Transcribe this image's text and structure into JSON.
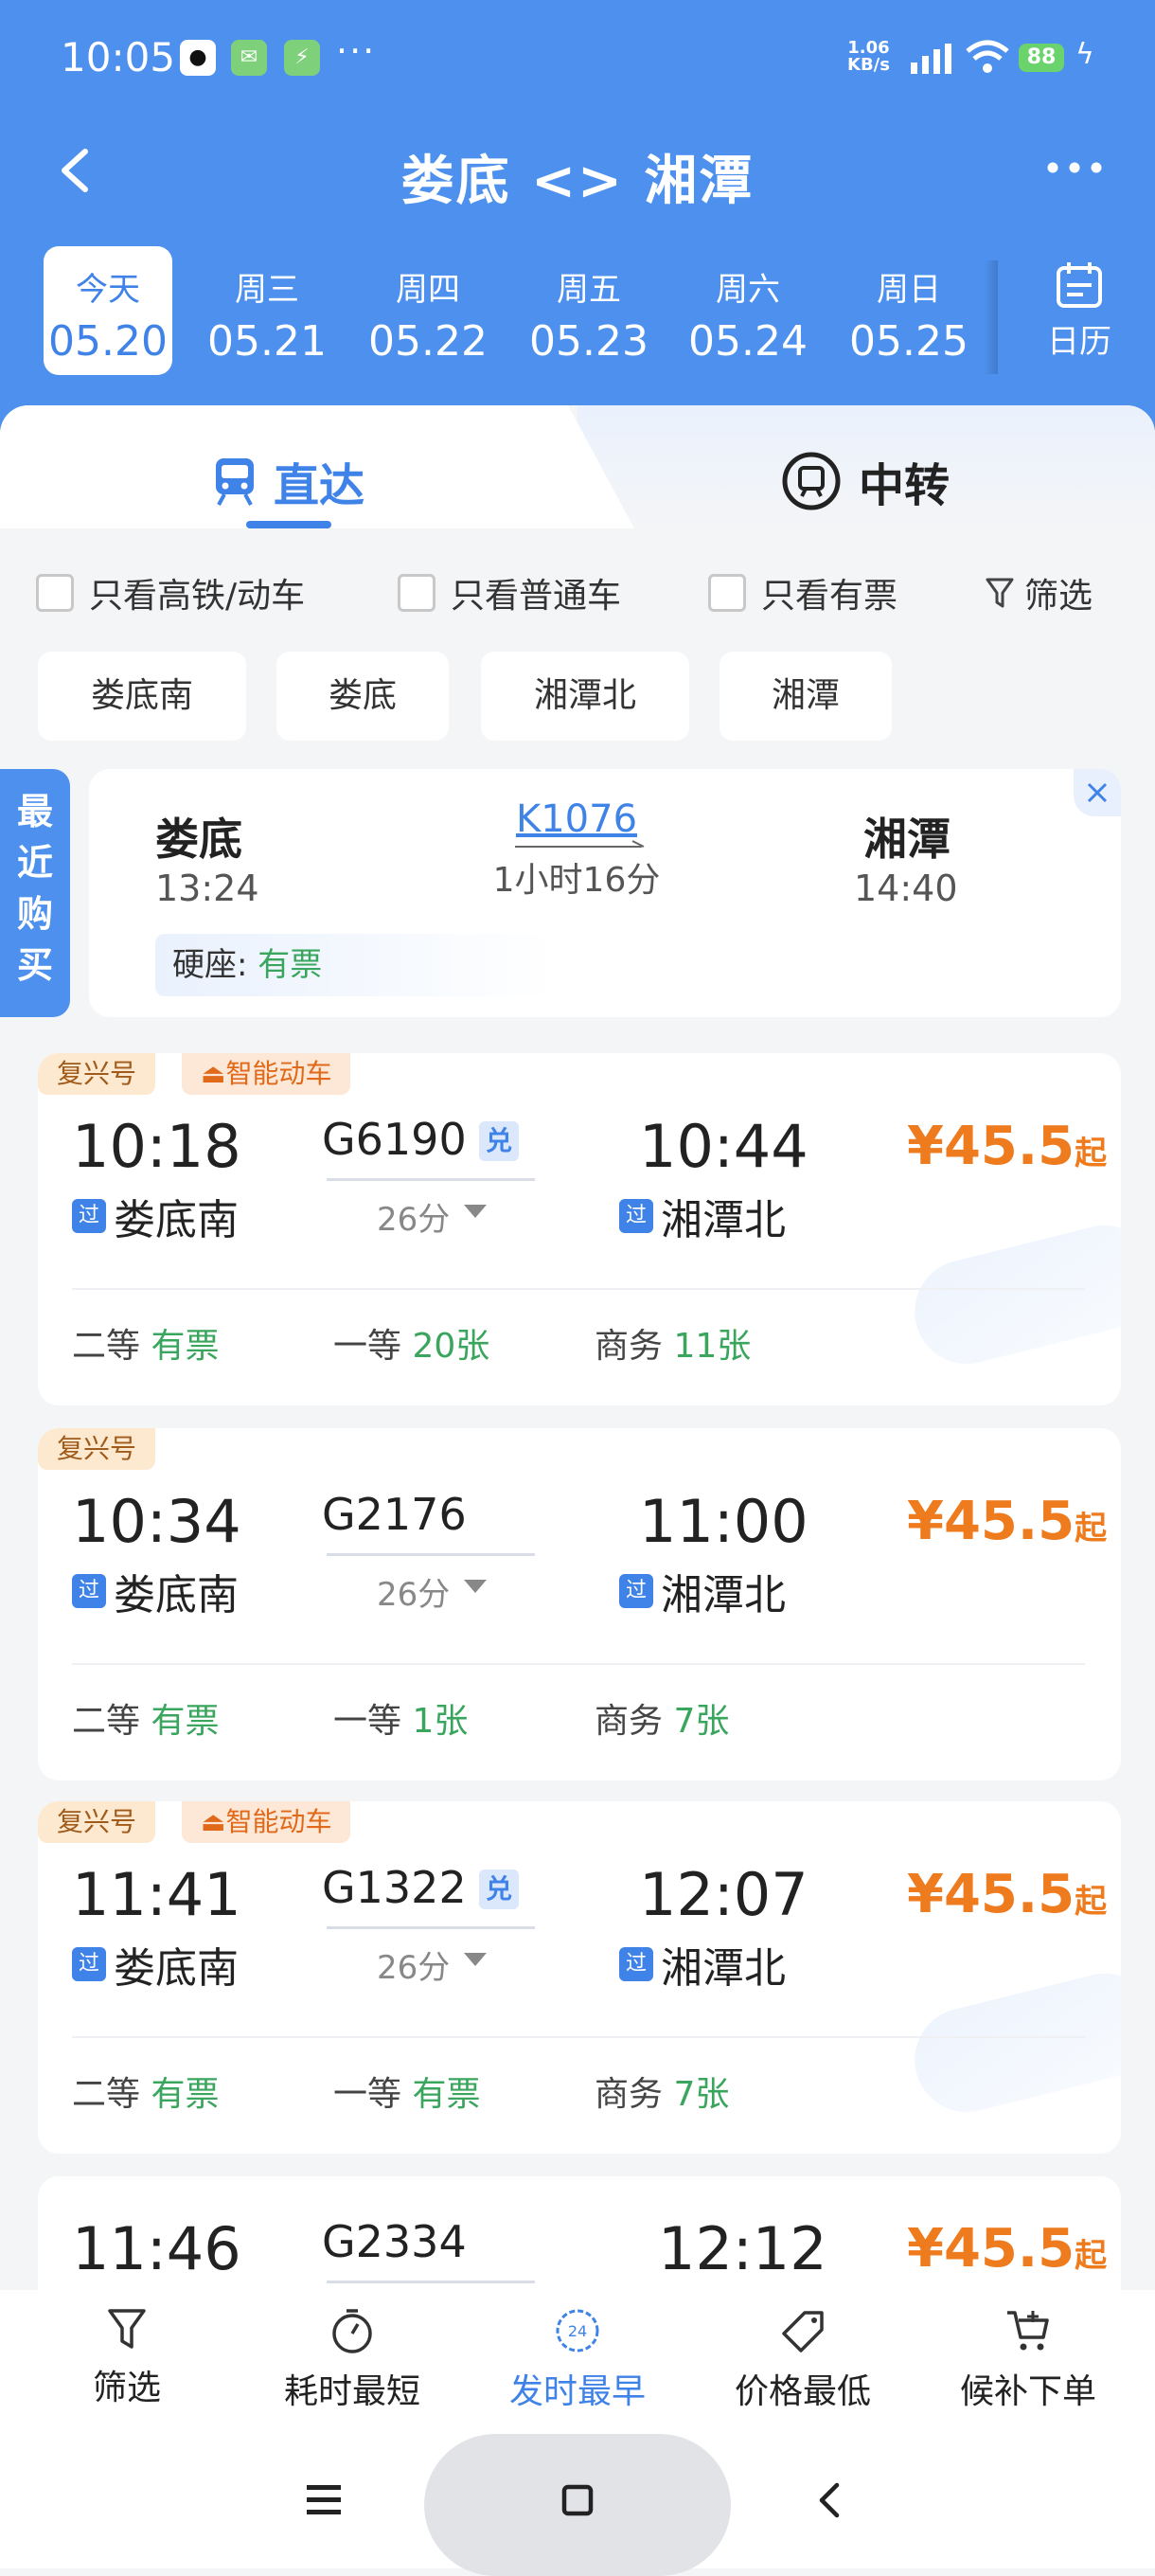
{
  "status_bar": {
    "time": "10:05",
    "net_speed": "1.06\nKB/s",
    "battery": "88"
  },
  "nav": {
    "title": "娄底 <> 湘潭"
  },
  "dates": [
    {
      "week": "今天",
      "date": "05.20",
      "selected": true
    },
    {
      "week": "周三",
      "date": "05.21"
    },
    {
      "week": "周四",
      "date": "05.22"
    },
    {
      "week": "周五",
      "date": "05.23"
    },
    {
      "week": "周六",
      "date": "05.24"
    },
    {
      "week": "周日",
      "date": "05.25"
    }
  ],
  "calendar_label": "日历",
  "tabs": {
    "direct": "直达",
    "transfer": "中转"
  },
  "filters": {
    "high_speed": "只看高铁/动车",
    "normal": "只看普通车",
    "available": "只看有票",
    "screen": "筛选"
  },
  "stations": [
    "娄底南",
    "娄底",
    "湘潭北",
    "湘潭"
  ],
  "recent": {
    "tab_label": "最近购买",
    "from": "娄底",
    "from_time": "13:24",
    "train_no": "K1076",
    "duration": "1小时16分",
    "to": "湘潭",
    "to_time": "14:40",
    "seat_label": "硬座:",
    "seat_status": "有票"
  },
  "trains": [
    {
      "tags": [
        "复兴号",
        "智能动车"
      ],
      "dep": "10:18",
      "train_no": "G6190",
      "exchange": "兑",
      "duration": "26分",
      "arr": "10:44",
      "from": "娄底南",
      "to": "湘潭北",
      "pass_badge": "过",
      "price": "¥45.5",
      "price_suffix": "起",
      "seats": [
        {
          "name": "二等",
          "status": "有票"
        },
        {
          "name": "一等",
          "status": "20张"
        },
        {
          "name": "商务",
          "status": "11张"
        }
      ]
    },
    {
      "tags": [
        "复兴号"
      ],
      "dep": "10:34",
      "train_no": "G2176",
      "exchange": "",
      "duration": "26分",
      "arr": "11:00",
      "from": "娄底南",
      "to": "湘潭北",
      "pass_badge": "过",
      "price": "¥45.5",
      "price_suffix": "起",
      "seats": [
        {
          "name": "二等",
          "status": "有票"
        },
        {
          "name": "一等",
          "status": "1张"
        },
        {
          "name": "商务",
          "status": "7张"
        }
      ]
    },
    {
      "tags": [
        "复兴号",
        "智能动车"
      ],
      "dep": "11:41",
      "train_no": "G1322",
      "exchange": "兑",
      "duration": "26分",
      "arr": "12:07",
      "from": "娄底南",
      "to": "湘潭北",
      "pass_badge": "过",
      "price": "¥45.5",
      "price_suffix": "起",
      "seats": [
        {
          "name": "二等",
          "status": "有票"
        },
        {
          "name": "一等",
          "status": "有票"
        },
        {
          "name": "商务",
          "status": "7张"
        }
      ]
    },
    {
      "tags": [],
      "dep": "11:46",
      "train_no": "G2334",
      "exchange": "",
      "duration": "",
      "arr": "12:12",
      "from": "",
      "to": "",
      "pass_badge": "",
      "price": "¥45.5",
      "price_suffix": "起",
      "seats": []
    }
  ],
  "bottom_bar": [
    {
      "label": "筛选",
      "icon": "filter-icon"
    },
    {
      "label": "耗时最短",
      "icon": "timer-icon"
    },
    {
      "label": "发时最早",
      "icon": "clock-24-icon",
      "active": true
    },
    {
      "label": "价格最低",
      "icon": "price-tag-icon"
    },
    {
      "label": "候补下单",
      "icon": "cart-plus-icon"
    }
  ],
  "colors": {
    "header": "#4d90ee",
    "accent": "#3f82e8",
    "price": "#ee7b1e",
    "available": "#3aa55d"
  }
}
